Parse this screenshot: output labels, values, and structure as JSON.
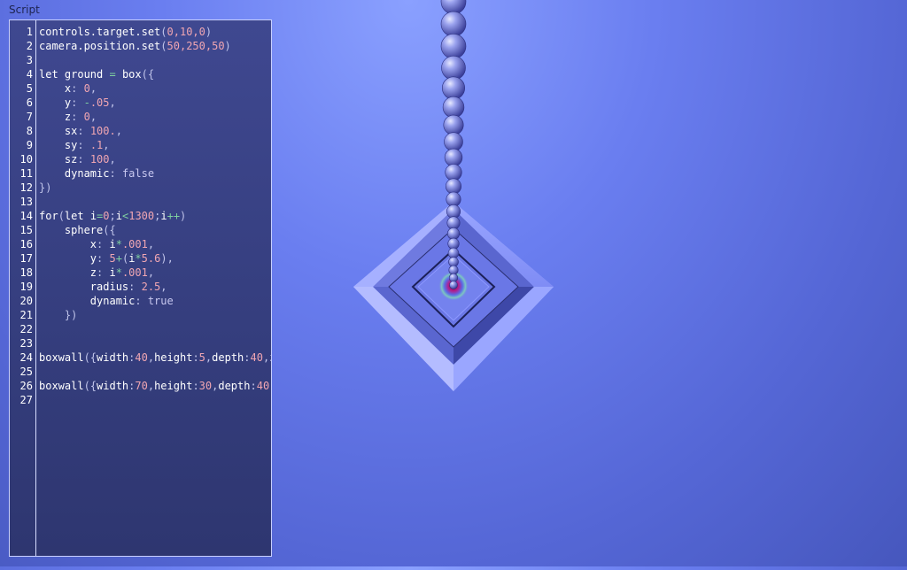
{
  "app": {
    "panel_title": "Script"
  },
  "editor": {
    "lines": [
      [
        [
          "controls.target.set",
          "kw"
        ],
        [
          "(",
          "pun"
        ],
        [
          "0,10,0",
          "num"
        ],
        [
          ")",
          "pun"
        ]
      ],
      [
        [
          "camera.position.set",
          "kw"
        ],
        [
          "(",
          "pun"
        ],
        [
          "50,250,50",
          "num"
        ],
        [
          ")",
          "pun"
        ]
      ],
      [],
      [
        [
          "let ground ",
          "kw"
        ],
        [
          "=",
          "op"
        ],
        [
          " box",
          "kw"
        ],
        [
          "({",
          "pun"
        ]
      ],
      [
        [
          "    x",
          "kw"
        ],
        [
          ": ",
          "pun"
        ],
        [
          "0",
          "num"
        ],
        [
          ",",
          "pun"
        ]
      ],
      [
        [
          "    y",
          "kw"
        ],
        [
          ": ",
          "pun"
        ],
        [
          "-",
          "op"
        ],
        [
          ".05",
          "num"
        ],
        [
          ",",
          "pun"
        ]
      ],
      [
        [
          "    z",
          "kw"
        ],
        [
          ": ",
          "pun"
        ],
        [
          "0",
          "num"
        ],
        [
          ",",
          "pun"
        ]
      ],
      [
        [
          "    sx",
          "kw"
        ],
        [
          ": ",
          "pun"
        ],
        [
          "100.",
          "num"
        ],
        [
          ",",
          "pun"
        ]
      ],
      [
        [
          "    sy",
          "kw"
        ],
        [
          ": ",
          "pun"
        ],
        [
          ".1",
          "num"
        ],
        [
          ",",
          "pun"
        ]
      ],
      [
        [
          "    sz",
          "kw"
        ],
        [
          ": ",
          "pun"
        ],
        [
          "100",
          "num"
        ],
        [
          ",",
          "pun"
        ]
      ],
      [
        [
          "    dynamic",
          "kw"
        ],
        [
          ": ",
          "pun"
        ],
        [
          "false",
          "bool"
        ]
      ],
      [
        [
          "})",
          "pun"
        ]
      ],
      [],
      [
        [
          "for",
          "kw"
        ],
        [
          "(",
          "pun"
        ],
        [
          "let i",
          "kw"
        ],
        [
          "=",
          "op"
        ],
        [
          "0",
          "num"
        ],
        [
          ";",
          "pun"
        ],
        [
          "i",
          "kw"
        ],
        [
          "<",
          "op"
        ],
        [
          "1300",
          "num"
        ],
        [
          ";",
          "pun"
        ],
        [
          "i",
          "kw"
        ],
        [
          "++",
          "op"
        ],
        [
          ")",
          "pun"
        ]
      ],
      [
        [
          "    sphere",
          "kw"
        ],
        [
          "({",
          "pun"
        ]
      ],
      [
        [
          "        x",
          "kw"
        ],
        [
          ": ",
          "pun"
        ],
        [
          "i",
          "kw"
        ],
        [
          "*",
          "op"
        ],
        [
          ".001",
          "num"
        ],
        [
          ",",
          "pun"
        ]
      ],
      [
        [
          "        y",
          "kw"
        ],
        [
          ": ",
          "pun"
        ],
        [
          "5",
          "num"
        ],
        [
          "+",
          "op"
        ],
        [
          "(",
          "pun"
        ],
        [
          "i",
          "kw"
        ],
        [
          "*",
          "op"
        ],
        [
          "5.6",
          "num"
        ],
        [
          "),",
          "pun"
        ]
      ],
      [
        [
          "        z",
          "kw"
        ],
        [
          ": ",
          "pun"
        ],
        [
          "i",
          "kw"
        ],
        [
          "*",
          "op"
        ],
        [
          ".001",
          "num"
        ],
        [
          ",",
          "pun"
        ]
      ],
      [
        [
          "        radius",
          "kw"
        ],
        [
          ": ",
          "pun"
        ],
        [
          "2.5",
          "num"
        ],
        [
          ",",
          "pun"
        ]
      ],
      [
        [
          "        dynamic",
          "kw"
        ],
        [
          ": ",
          "pun"
        ],
        [
          "true",
          "bool"
        ]
      ],
      [
        [
          "    })",
          "pun"
        ]
      ],
      [],
      [],
      [
        [
          "boxwall",
          "kw"
        ],
        [
          "({",
          "pun"
        ],
        [
          "width",
          "kw"
        ],
        [
          ":",
          "pun"
        ],
        [
          "40",
          "num"
        ],
        [
          ",",
          "pun"
        ],
        [
          "height",
          "kw"
        ],
        [
          ":",
          "pun"
        ],
        [
          "5",
          "num"
        ],
        [
          ",",
          "pun"
        ],
        [
          "depth",
          "kw"
        ],
        [
          ":",
          "pun"
        ],
        [
          "40",
          "num"
        ],
        [
          ",z",
          "pun"
        ]
      ],
      [],
      [
        [
          "boxwall",
          "kw"
        ],
        [
          "({",
          "pun"
        ],
        [
          "width",
          "kw"
        ],
        [
          ":",
          "pun"
        ],
        [
          "70",
          "num"
        ],
        [
          ",",
          "pun"
        ],
        [
          "height",
          "kw"
        ],
        [
          ":",
          "pun"
        ],
        [
          "30",
          "num"
        ],
        [
          ",",
          "pun"
        ],
        [
          "depth",
          "kw"
        ],
        [
          ":",
          "pun"
        ],
        [
          "40",
          "num"
        ]
      ],
      []
    ]
  },
  "colors": {
    "number": "#f0a6b2",
    "operator": "#7fd0a0",
    "keyword": "#ffffff",
    "boolean": "#c8c8f0"
  }
}
